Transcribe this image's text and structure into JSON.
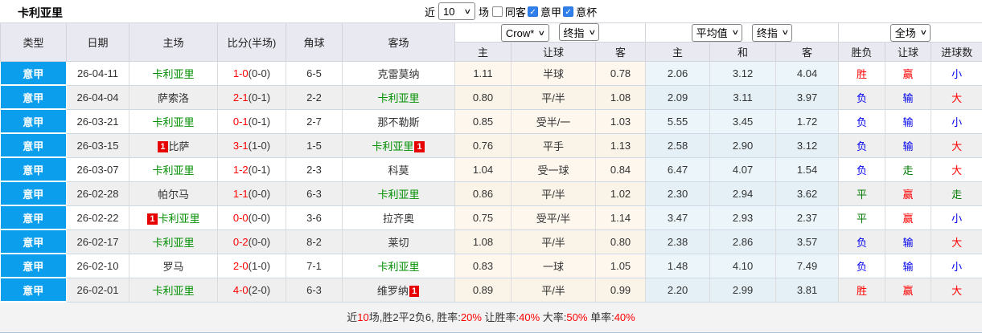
{
  "header": {
    "title": "卡利亚里",
    "filter": {
      "recent_label": "近",
      "recent_value": "10",
      "recent_suffix": "场",
      "checkboxes": [
        {
          "label": "同客",
          "checked": false
        },
        {
          "label": "意甲",
          "checked": true
        },
        {
          "label": "意杯",
          "checked": true
        }
      ]
    }
  },
  "icons": {
    "chevron_down": "∨",
    "check": "✓"
  },
  "colors": {
    "league_cell_blue": "#0a9eec",
    "win_red": "#ff0000",
    "lose_blue": "#0000ee",
    "draw_green": "#007a00",
    "team_green": "#008f00",
    "score_red": "#ff0000"
  },
  "table": {
    "columns": [
      "类型",
      "日期",
      "主场",
      "比分(半场)",
      "角球",
      "客场"
    ],
    "ah_group": {
      "selects": [
        "Crow*",
        "终指"
      ],
      "cols": [
        "主",
        "让球",
        "客"
      ]
    },
    "eu_group": {
      "selects": [
        "平均值",
        "终指"
      ],
      "cols": [
        "主",
        "和",
        "客"
      ]
    },
    "result_group": {
      "selects": [
        "全场"
      ],
      "cols": [
        "胜负",
        "让球",
        "进球数"
      ]
    },
    "rows": [
      {
        "type": "意甲",
        "date": "26-04-11",
        "home": {
          "name": "卡利亚里",
          "green": true
        },
        "score_ft": "1-0",
        "score_ht": "(0-0)",
        "corners": "6-5",
        "away": {
          "name": "克雷莫纳",
          "green": false
        },
        "ah": [
          "1.11",
          "半球",
          "0.78"
        ],
        "eu": [
          "2.06",
          "3.12",
          "4.04"
        ],
        "result": [
          {
            "text": "胜",
            "color": "red"
          },
          {
            "text": "赢",
            "color": "red"
          },
          {
            "text": "小",
            "color": "blue"
          }
        ]
      },
      {
        "type": "意甲",
        "date": "26-04-04",
        "home": {
          "name": "萨索洛",
          "green": false
        },
        "score_ft": "2-1",
        "score_ht": "(0-1)",
        "corners": "2-2",
        "away": {
          "name": "卡利亚里",
          "green": true
        },
        "ah": [
          "0.80",
          "平/半",
          "1.08"
        ],
        "eu": [
          "2.09",
          "3.11",
          "3.97"
        ],
        "result": [
          {
            "text": "负",
            "color": "blue"
          },
          {
            "text": "输",
            "color": "blue"
          },
          {
            "text": "大",
            "color": "red"
          }
        ]
      },
      {
        "type": "意甲",
        "date": "26-03-21",
        "home": {
          "name": "卡利亚里",
          "green": true
        },
        "score_ft": "0-1",
        "score_ht": "(0-1)",
        "corners": "2-7",
        "away": {
          "name": "那不勒斯",
          "green": false
        },
        "ah": [
          "0.85",
          "受半/一",
          "1.03"
        ],
        "eu": [
          "5.55",
          "3.45",
          "1.72"
        ],
        "result": [
          {
            "text": "负",
            "color": "blue"
          },
          {
            "text": "输",
            "color": "blue"
          },
          {
            "text": "小",
            "color": "blue"
          }
        ]
      },
      {
        "type": "意甲",
        "date": "26-03-15",
        "home": {
          "name": "比萨",
          "green": false,
          "badge_before": "1"
        },
        "score_ft": "3-1",
        "score_ht": "(1-0)",
        "corners": "1-5",
        "away": {
          "name": "卡利亚里",
          "green": true,
          "badge_after": "1"
        },
        "ah": [
          "0.76",
          "平手",
          "1.13"
        ],
        "eu": [
          "2.58",
          "2.90",
          "3.12"
        ],
        "result": [
          {
            "text": "负",
            "color": "blue"
          },
          {
            "text": "输",
            "color": "blue"
          },
          {
            "text": "大",
            "color": "red"
          }
        ]
      },
      {
        "type": "意甲",
        "date": "26-03-07",
        "home": {
          "name": "卡利亚里",
          "green": true
        },
        "score_ft": "1-2",
        "score_ht": "(0-1)",
        "corners": "2-3",
        "away": {
          "name": "科莫",
          "green": false
        },
        "ah": [
          "1.04",
          "受一球",
          "0.84"
        ],
        "eu": [
          "6.47",
          "4.07",
          "1.54"
        ],
        "result": [
          {
            "text": "负",
            "color": "blue"
          },
          {
            "text": "走",
            "color": "green"
          },
          {
            "text": "大",
            "color": "red"
          }
        ]
      },
      {
        "type": "意甲",
        "date": "26-02-28",
        "home": {
          "name": "帕尔马",
          "green": false
        },
        "score_ft": "1-1",
        "score_ht": "(0-0)",
        "corners": "6-3",
        "away": {
          "name": "卡利亚里",
          "green": true
        },
        "ah": [
          "0.86",
          "平/半",
          "1.02"
        ],
        "eu": [
          "2.30",
          "2.94",
          "3.62"
        ],
        "result": [
          {
            "text": "平",
            "color": "green"
          },
          {
            "text": "赢",
            "color": "red"
          },
          {
            "text": "走",
            "color": "green"
          }
        ]
      },
      {
        "type": "意甲",
        "date": "26-02-22",
        "home": {
          "name": "卡利亚里",
          "green": true,
          "badge_before": "1"
        },
        "score_ft": "0-0",
        "score_ht": "(0-0)",
        "corners": "3-6",
        "away": {
          "name": "拉齐奥",
          "green": false
        },
        "ah": [
          "0.75",
          "受平/半",
          "1.14"
        ],
        "eu": [
          "3.47",
          "2.93",
          "2.37"
        ],
        "result": [
          {
            "text": "平",
            "color": "green"
          },
          {
            "text": "赢",
            "color": "red"
          },
          {
            "text": "小",
            "color": "blue"
          }
        ]
      },
      {
        "type": "意甲",
        "date": "26-02-17",
        "home": {
          "name": "卡利亚里",
          "green": true
        },
        "score_ft": "0-2",
        "score_ht": "(0-0)",
        "corners": "8-2",
        "away": {
          "name": "莱切",
          "green": false
        },
        "ah": [
          "1.08",
          "平/半",
          "0.80"
        ],
        "eu": [
          "2.38",
          "2.86",
          "3.57"
        ],
        "result": [
          {
            "text": "负",
            "color": "blue"
          },
          {
            "text": "输",
            "color": "blue"
          },
          {
            "text": "大",
            "color": "red"
          }
        ]
      },
      {
        "type": "意甲",
        "date": "26-02-10",
        "home": {
          "name": "罗马",
          "green": false
        },
        "score_ft": "2-0",
        "score_ht": "(1-0)",
        "corners": "7-1",
        "away": {
          "name": "卡利亚里",
          "green": true
        },
        "ah": [
          "0.83",
          "一球",
          "1.05"
        ],
        "eu": [
          "1.48",
          "4.10",
          "7.49"
        ],
        "result": [
          {
            "text": "负",
            "color": "blue"
          },
          {
            "text": "输",
            "color": "blue"
          },
          {
            "text": "小",
            "color": "blue"
          }
        ]
      },
      {
        "type": "意甲",
        "date": "26-02-01",
        "home": {
          "name": "卡利亚里",
          "green": true
        },
        "score_ft": "4-0",
        "score_ht": "(2-0)",
        "corners": "6-3",
        "away": {
          "name": "维罗纳",
          "green": false,
          "badge_after": "1"
        },
        "ah": [
          "0.89",
          "平/半",
          "0.99"
        ],
        "eu": [
          "2.20",
          "2.99",
          "3.81"
        ],
        "result": [
          {
            "text": "胜",
            "color": "red"
          },
          {
            "text": "赢",
            "color": "red"
          },
          {
            "text": "大",
            "color": "red"
          }
        ]
      }
    ]
  },
  "footer": {
    "segments": [
      {
        "text": "近",
        "red": false
      },
      {
        "text": "10",
        "red": true
      },
      {
        "text": "场,胜2平2负6, 胜率:",
        "red": false
      },
      {
        "text": "20%",
        "red": true
      },
      {
        "text": " 让胜率:",
        "red": false
      },
      {
        "text": "40%",
        "red": true
      },
      {
        "text": " 大率:",
        "red": false
      },
      {
        "text": "50%",
        "red": true
      },
      {
        "text": " 单率:",
        "red": false
      },
      {
        "text": "40%",
        "red": true
      }
    ]
  }
}
